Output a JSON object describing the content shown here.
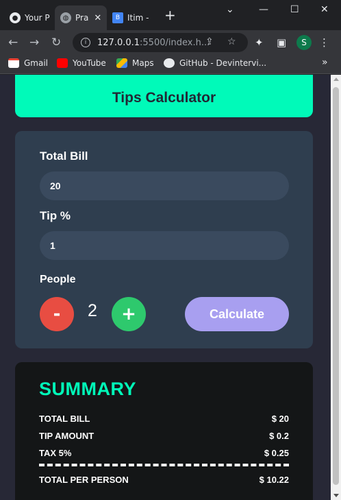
{
  "browser": {
    "tabs": [
      {
        "label": "Your P"
      },
      {
        "label": "Pra"
      },
      {
        "label": "Itim - "
      }
    ],
    "new_tab": "+",
    "address": {
      "host": "127.0.0.1",
      "path": ":5500/index.h..."
    },
    "profile_initial": "S",
    "bookmarks": [
      {
        "label": "Gmail"
      },
      {
        "label": "YouTube"
      },
      {
        "label": "Maps"
      },
      {
        "label": "GitHub - Devintervi..."
      }
    ],
    "more": "»"
  },
  "app": {
    "title": "Tips Calculator",
    "total_bill_label": "Total Bill",
    "total_bill_value": "20",
    "tip_label": "Tip %",
    "tip_value": "1",
    "people_label": "People",
    "minus_label": "-",
    "people_count": "2",
    "plus_label": "+",
    "calculate_label": "Calculate"
  },
  "summary": {
    "title": "SUMMARY",
    "rows": [
      {
        "label": "TOTAL BILL",
        "value": "$ 20"
      },
      {
        "label": "TIP AMOUNT",
        "value": "$ 0.2"
      },
      {
        "label": "TAX 5%",
        "value": "$ 0.25"
      }
    ],
    "total_label": "TOTAL PER PERSON",
    "total_value": "$ 10.22"
  },
  "colors": {
    "accent": "#00fab9",
    "card": "#2f3e4f",
    "input": "#3a4a5e",
    "minus": "#e84d42",
    "plus": "#2ec96d",
    "calculate": "#a89ff0",
    "summary_bg": "#141617"
  }
}
